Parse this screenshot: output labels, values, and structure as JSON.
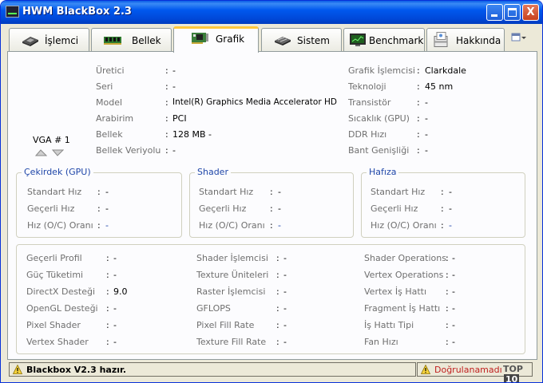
{
  "window": {
    "title": "HWM BlackBox 2.3",
    "minimize": "",
    "maximize": "",
    "close": "X"
  },
  "tabs": [
    {
      "label": "İşlemci",
      "icon": "cpu-chip-icon"
    },
    {
      "label": "Bellek",
      "icon": "ram-module-icon"
    },
    {
      "label": "Grafik",
      "icon": "graphics-card-icon"
    },
    {
      "label": "Sistem",
      "icon": "motherboard-icon"
    },
    {
      "label": "Benchmark",
      "icon": "benchmark-monitor-icon"
    },
    {
      "label": "Hakkında",
      "icon": "about-box-icon"
    }
  ],
  "vga": {
    "label": "VGA # 1"
  },
  "info_left": [
    {
      "label": "Üretici",
      "value": "-"
    },
    {
      "label": "Seri",
      "value": "-"
    },
    {
      "label": "Model",
      "value": "Intel(R) Graphics Media Accelerator HD"
    },
    {
      "label": "Arabirim",
      "value": "PCI"
    },
    {
      "label": "Bellek",
      "value": "128 MB -"
    },
    {
      "label": "Bellek Veriyolu",
      "value": "-"
    }
  ],
  "info_right": [
    {
      "label": "Grafik İşlemcisi",
      "value": "Clarkdale"
    },
    {
      "label": "Teknoloji",
      "value": "45 nm"
    },
    {
      "label": "Transistör",
      "value": "-"
    },
    {
      "label": "Sıcaklık (GPU)",
      "value": "-"
    },
    {
      "label": "DDR Hızı",
      "value": "-"
    },
    {
      "label": "Bant Genişliği",
      "value": "-"
    }
  ],
  "groups": [
    {
      "title": "Çekirdek (GPU)",
      "rows": [
        {
          "label": "Standart Hız",
          "value": "-"
        },
        {
          "label": "Geçerli Hız",
          "value": "-"
        },
        {
          "label": "Hız (O/C) Oranı",
          "value": "-"
        }
      ]
    },
    {
      "title": "Shader",
      "rows": [
        {
          "label": "Standart Hız",
          "value": "-"
        },
        {
          "label": "Geçerli Hız",
          "value": "-"
        },
        {
          "label": "Hız (O/C) Oranı",
          "value": "-"
        }
      ]
    },
    {
      "title": "Hafıza",
      "rows": [
        {
          "label": "Standart Hız",
          "value": "-"
        },
        {
          "label": "Geçerli Hız",
          "value": "-"
        },
        {
          "label": "Hız (O/C) Oranı",
          "value": "-"
        }
      ]
    }
  ],
  "details": [
    {
      "label": "Geçerli Profil",
      "value": "-"
    },
    {
      "label": "Güç Tüketimi",
      "value": "-"
    },
    {
      "label": "DirectX Desteği",
      "value": "9.0"
    },
    {
      "label": "OpenGL Desteği",
      "value": "-"
    },
    {
      "label": "Pixel Shader",
      "value": "-"
    },
    {
      "label": "Vertex Shader",
      "value": "-"
    },
    {
      "label": "Shader İşlemcisi",
      "value": "-"
    },
    {
      "label": "Texture Üniteleri",
      "value": "-"
    },
    {
      "label": "Raster İşlemcisi",
      "value": "-"
    },
    {
      "label": "GFLOPS",
      "value": "-"
    },
    {
      "label": "Pixel Fill Rate",
      "value": "-"
    },
    {
      "label": "Texture Fill Rate",
      "value": "-"
    },
    {
      "label": "Shader Operations",
      "value": "-"
    },
    {
      "label": "Vertex Operations",
      "value": "-"
    },
    {
      "label": "Vertex İş Hattı",
      "value": "-"
    },
    {
      "label": "Fragment İş Hattı",
      "value": "-"
    },
    {
      "label": "İş Hattı Tipi",
      "value": "-"
    },
    {
      "label": "Fan Hızı",
      "value": "-"
    }
  ],
  "status": {
    "left": "Blackbox V2.3 hazır.",
    "right": "Doğrulanamadı",
    "brand": "TOP",
    "brand_box": "10"
  },
  "colors": {
    "accent": "#1f46a8",
    "title_bar": "#0058ee",
    "warning": "#c02020",
    "tab_highlight": "#ffc83c"
  }
}
